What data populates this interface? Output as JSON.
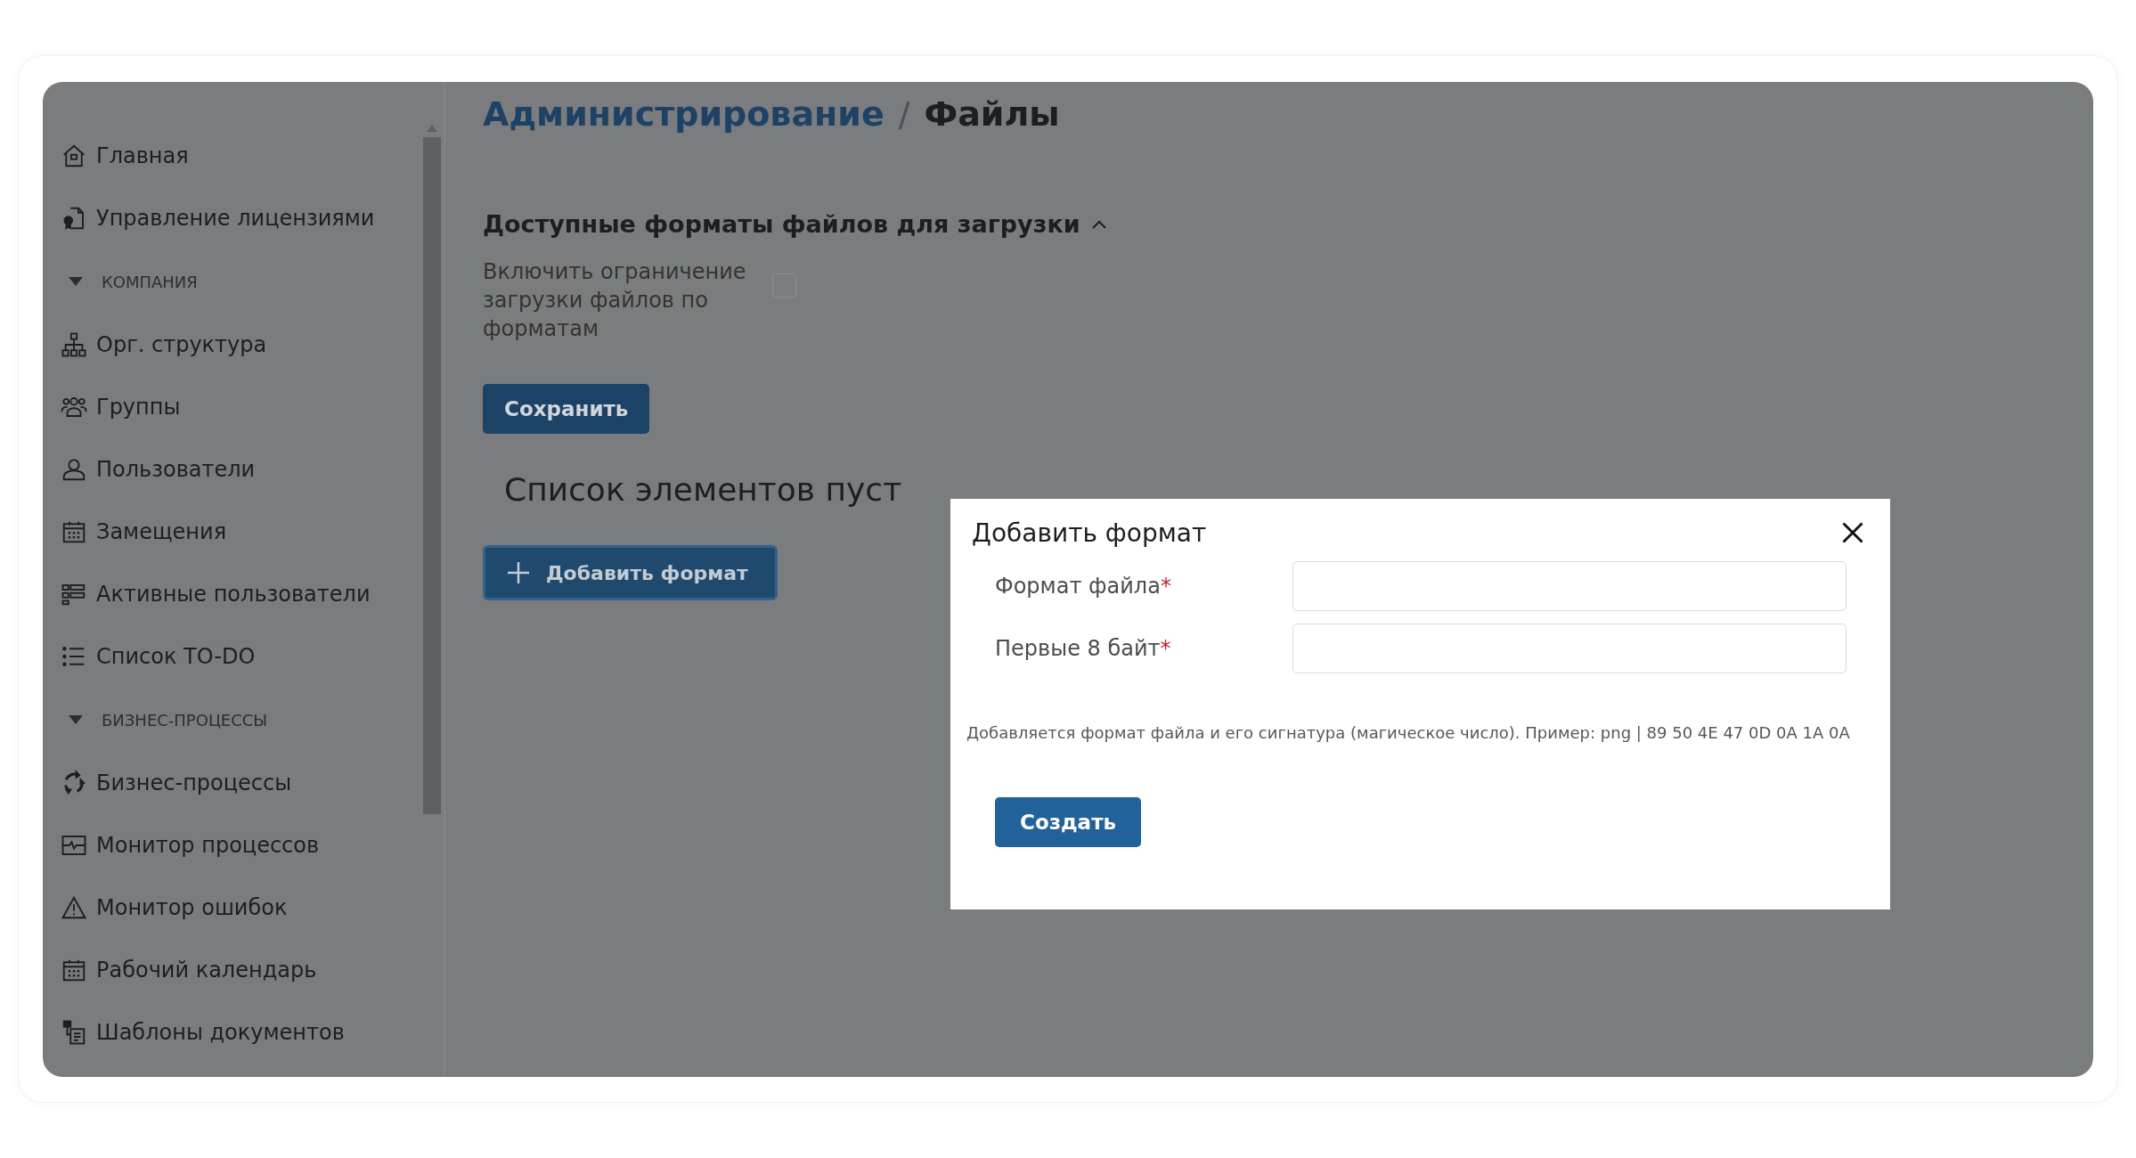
{
  "sidebar": {
    "items": [
      {
        "kind": "link",
        "label": "Главная"
      },
      {
        "kind": "link",
        "label": "Управление лицензиями"
      },
      {
        "kind": "section",
        "label": "КОМПАНИЯ",
        "expanded": true
      },
      {
        "kind": "link",
        "label": "Орг. структура"
      },
      {
        "kind": "link",
        "label": "Группы"
      },
      {
        "kind": "link",
        "label": "Пользователи"
      },
      {
        "kind": "link",
        "label": "Замещения"
      },
      {
        "kind": "link",
        "label": "Активные пользователи"
      },
      {
        "kind": "link",
        "label": "Список TO-DO"
      },
      {
        "kind": "section",
        "label": "БИЗНЕС-ПРОЦЕССЫ",
        "expanded": true
      },
      {
        "kind": "link",
        "label": "Бизнес-процессы"
      },
      {
        "kind": "link",
        "label": "Монитор процессов"
      },
      {
        "kind": "link",
        "label": "Монитор ошибок"
      },
      {
        "kind": "link",
        "label": "Рабочий календарь"
      },
      {
        "kind": "link",
        "label": "Шаблоны документов"
      }
    ]
  },
  "breadcrumb": [
    {
      "label": "Администрирование",
      "kind": "link"
    },
    {
      "label": "/",
      "kind": "separator"
    },
    {
      "label": "Файлы",
      "kind": "current"
    }
  ],
  "section": {
    "title": "Доступные форматы файлов для загрузки",
    "expanded": true,
    "checkbox": {
      "label": "Включить ограничение загрузки файлов по форматам",
      "checked": false
    },
    "save_button": "Сохранить"
  },
  "empty_message": "Список элементов пуст",
  "add_button": "Добавить формат",
  "dialog": {
    "title": "Добавить формат",
    "fields": [
      {
        "label": "Формат файла",
        "required_mark": "*"
      },
      {
        "label": "Первые 8 байт",
        "required_mark": "*"
      }
    ],
    "hint": "Добавляется формат файла и его сигнатура (магическое число). Пример: png | 89 50 4E 47 0D 0A 1A 0A",
    "create_button": "Создать"
  }
}
